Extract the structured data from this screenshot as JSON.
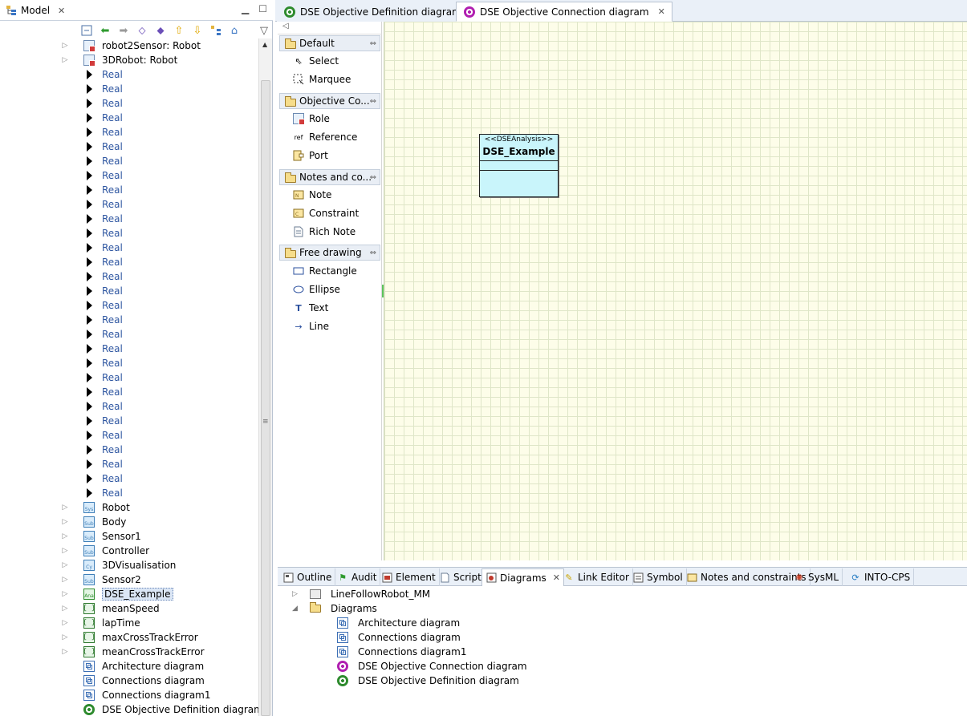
{
  "model_view": {
    "title": "Model",
    "tree": [
      {
        "label": "robot2Sensor: Robot",
        "icon": "robot-part-icon",
        "expandable": true
      },
      {
        "label": "3DRobot: Robot",
        "icon": "robot-part-icon",
        "expandable": true
      },
      {
        "label": "Real",
        "icon": "real-value-icon"
      },
      {
        "label": "Real",
        "icon": "real-value-icon"
      },
      {
        "label": "Real",
        "icon": "real-value-icon"
      },
      {
        "label": "Real",
        "icon": "real-value-icon"
      },
      {
        "label": "Real",
        "icon": "real-value-icon"
      },
      {
        "label": "Real",
        "icon": "real-value-icon"
      },
      {
        "label": "Real",
        "icon": "real-value-icon"
      },
      {
        "label": "Real",
        "icon": "real-value-icon"
      },
      {
        "label": "Real",
        "icon": "real-value-icon"
      },
      {
        "label": "Real",
        "icon": "real-value-icon"
      },
      {
        "label": "Real",
        "icon": "real-value-icon"
      },
      {
        "label": "Real",
        "icon": "real-value-icon"
      },
      {
        "label": "Real",
        "icon": "real-value-icon"
      },
      {
        "label": "Real",
        "icon": "real-value-icon"
      },
      {
        "label": "Real",
        "icon": "real-value-icon"
      },
      {
        "label": "Real",
        "icon": "real-value-icon"
      },
      {
        "label": "Real",
        "icon": "real-value-icon"
      },
      {
        "label": "Real",
        "icon": "real-value-icon"
      },
      {
        "label": "Real",
        "icon": "real-value-icon"
      },
      {
        "label": "Real",
        "icon": "real-value-icon"
      },
      {
        "label": "Real",
        "icon": "real-value-icon"
      },
      {
        "label": "Real",
        "icon": "real-value-icon"
      },
      {
        "label": "Real",
        "icon": "real-value-icon"
      },
      {
        "label": "Real",
        "icon": "real-value-icon"
      },
      {
        "label": "Real",
        "icon": "real-value-icon"
      },
      {
        "label": "Real",
        "icon": "real-value-icon"
      },
      {
        "label": "Real",
        "icon": "real-value-icon"
      },
      {
        "label": "Real",
        "icon": "real-value-icon"
      },
      {
        "label": "Real",
        "icon": "real-value-icon"
      },
      {
        "label": "Real",
        "icon": "real-value-icon"
      },
      {
        "label": "Robot",
        "icon": "sys-block-icon",
        "badge": "Sys",
        "expandable": true
      },
      {
        "label": "Body",
        "icon": "sub-block-icon",
        "badge": "Sub",
        "expandable": true
      },
      {
        "label": "Sensor1",
        "icon": "sub-block-icon",
        "badge": "Sub",
        "expandable": true
      },
      {
        "label": "Controller",
        "icon": "sub-block-icon",
        "badge": "Sub",
        "expandable": true
      },
      {
        "label": "3DVisualisation",
        "icon": "cy-block-icon",
        "badge": "Cy",
        "expandable": true
      },
      {
        "label": "Sensor2",
        "icon": "sub-block-icon",
        "badge": "Sub",
        "expandable": true
      },
      {
        "label": "DSE_Example",
        "icon": "analysis-block-icon",
        "badge": "Ana",
        "expandable": true,
        "selected": true
      },
      {
        "label": "meanSpeed",
        "icon": "objective-icon",
        "expandable": true
      },
      {
        "label": "lapTime",
        "icon": "objective-icon",
        "expandable": true
      },
      {
        "label": "maxCrossTrackError",
        "icon": "objective-icon",
        "expandable": true
      },
      {
        "label": "meanCrossTrackError",
        "icon": "objective-icon",
        "expandable": true
      },
      {
        "label": "Architecture diagram",
        "icon": "architecture-diagram-icon"
      },
      {
        "label": "Connections diagram",
        "icon": "connections-diagram-icon"
      },
      {
        "label": "Connections diagram1",
        "icon": "connections-diagram-icon"
      },
      {
        "label": "DSE Objective Definition diagram",
        "icon": "dse-definition-diagram-icon"
      },
      {
        "label": "DSE Objective Connection diagram",
        "icon": "dse-connection-diagram-icon"
      }
    ]
  },
  "editor": {
    "tabs": [
      {
        "label": "DSE Objective Definition diagram",
        "active": false
      },
      {
        "label": "DSE Objective Connection diagram",
        "active": true
      }
    ],
    "palette": {
      "drawers": [
        {
          "label": "Default",
          "tools": [
            "Select",
            "Marquee"
          ]
        },
        {
          "label": "Objective Co...",
          "tools": [
            "Role",
            "Reference",
            "Port"
          ]
        },
        {
          "label": "Notes and co...",
          "tools": [
            "Note",
            "Constraint",
            "Rich Note"
          ]
        },
        {
          "label": "Free drawing",
          "tools": [
            "Rectangle",
            "Ellipse",
            "Text",
            "Line"
          ]
        }
      ]
    },
    "canvas": {
      "node": {
        "stereotype": "<<DSEAnalysis>>",
        "name": "DSE_Example",
        "fill": "#c9f5fb"
      },
      "background": "#fdfde9"
    }
  },
  "bottom_view": {
    "tabs": [
      {
        "label": "Outline",
        "icon": "outline-icon"
      },
      {
        "label": "Audit",
        "icon": "audit-flag-icon"
      },
      {
        "label": "Element",
        "icon": "element-icon"
      },
      {
        "label": "Script",
        "icon": "script-icon"
      },
      {
        "label": "Diagrams",
        "icon": "diagrams-icon",
        "active": true
      },
      {
        "label": "Link Editor",
        "icon": "link-editor-icon"
      },
      {
        "label": "Symbol",
        "icon": "symbol-icon"
      },
      {
        "label": "Notes and constraints",
        "icon": "notes-icon"
      },
      {
        "label": "SysML",
        "icon": "sysml-icon"
      },
      {
        "label": "INTO-CPS",
        "icon": "into-cps-icon"
      }
    ],
    "tree": [
      {
        "label": "LineFollowRobot_MM",
        "icon": "project-icon",
        "level": 0,
        "expander": "collapsed"
      },
      {
        "label": "Diagrams",
        "icon": "folder-icon",
        "level": 0,
        "expander": "expanded"
      },
      {
        "label": "Architecture diagram",
        "icon": "architecture-diagram-icon",
        "level": 1
      },
      {
        "label": "Connections diagram",
        "icon": "connections-diagram-icon",
        "level": 1
      },
      {
        "label": "Connections diagram1",
        "icon": "connections-diagram-icon",
        "level": 1
      },
      {
        "label": "DSE Objective Connection diagram",
        "icon": "dse-connection-diagram-icon",
        "level": 1
      },
      {
        "label": "DSE Objective Definition diagram",
        "icon": "dse-definition-diagram-icon",
        "level": 1
      }
    ]
  },
  "colors": {
    "real_label": "#2d55a0",
    "tab_bar": "#eaf0f8",
    "selection": "#dbe6f5"
  }
}
